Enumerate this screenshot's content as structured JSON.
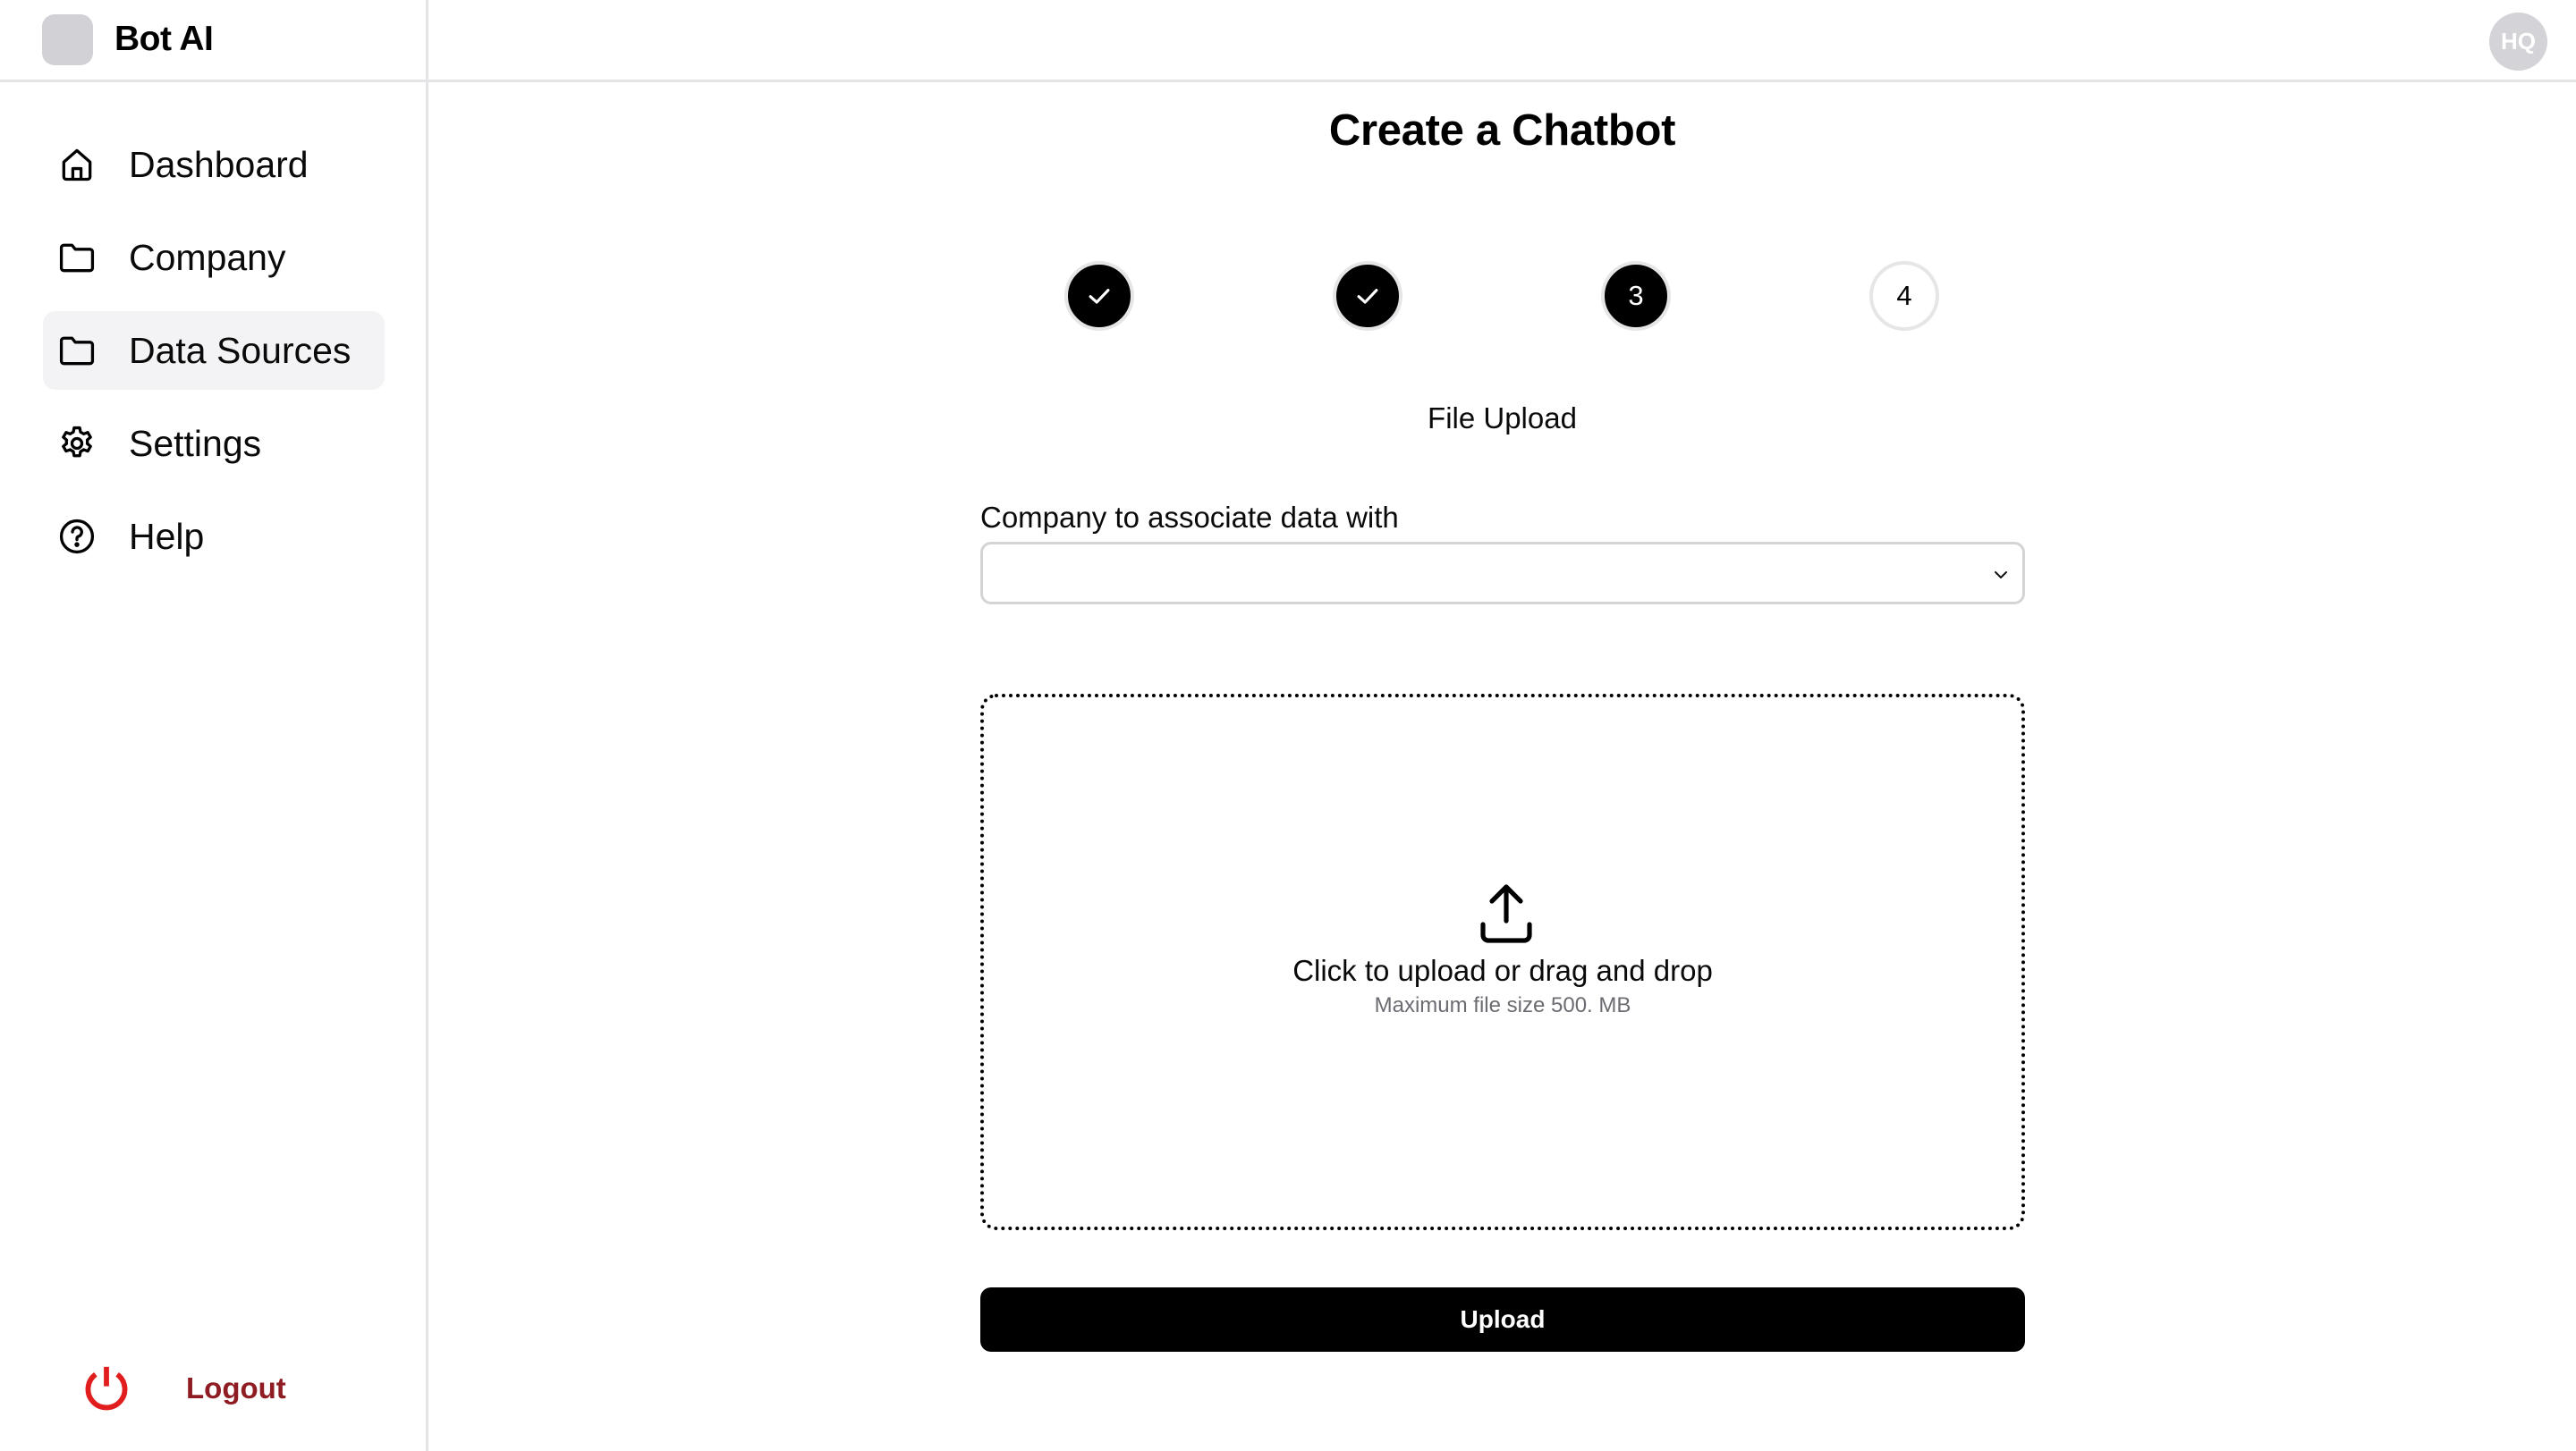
{
  "app": {
    "brand": "Bot AI",
    "user_initials": "HQ"
  },
  "sidebar": {
    "items": [
      {
        "label": "Dashboard",
        "icon": "home-icon",
        "active": false
      },
      {
        "label": "Company",
        "icon": "folder-icon",
        "active": false
      },
      {
        "label": "Data Sources",
        "icon": "folder-icon",
        "active": true
      },
      {
        "label": "Settings",
        "icon": "gear-icon",
        "active": false
      },
      {
        "label": "Help",
        "icon": "help-circle-icon",
        "active": false
      }
    ],
    "logout_label": "Logout",
    "logout_icon": "power-icon"
  },
  "main": {
    "title": "Create a Chatbot",
    "stepper": {
      "steps": [
        {
          "number": "1",
          "status": "completed",
          "icon": "check-icon"
        },
        {
          "number": "2",
          "status": "completed",
          "icon": "check-icon"
        },
        {
          "number": "3",
          "status": "current"
        },
        {
          "number": "4",
          "status": "upcoming"
        }
      ],
      "current_step_title": "File Upload"
    },
    "company_field": {
      "label": "Company to associate data with",
      "value": ""
    },
    "dropzone": {
      "icon": "upload-icon",
      "title": "Click to upload or drag and drop",
      "subtitle": "Maximum file size 500. MB"
    },
    "upload_button_label": "Upload"
  },
  "colors": {
    "accent": "#000000",
    "logout": "#8e1c22",
    "logout_icon": "#e11d1d",
    "active_nav_bg": "#f3f3f5",
    "avatar_bg": "#d4d4d8",
    "border": "#e5e5e7"
  }
}
